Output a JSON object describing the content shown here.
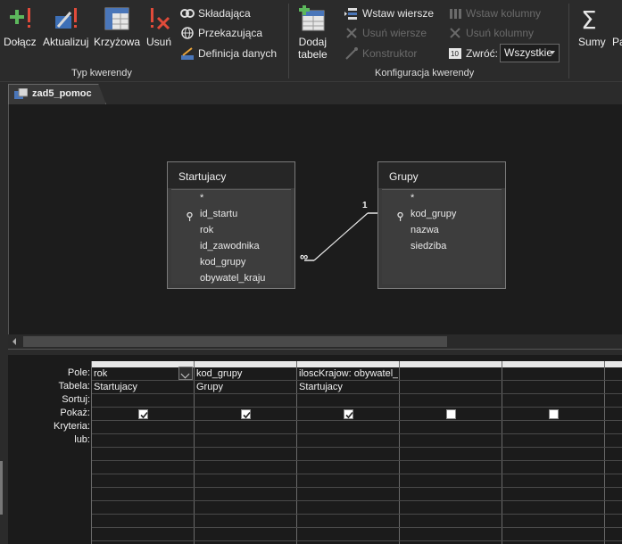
{
  "ribbon": {
    "query_type_group_label": "Typ kwerendy",
    "config_group_label": "Konfiguracja kwerendy",
    "buttons": {
      "append": "Dołącz",
      "update": "Aktualizuj",
      "crosstab": "Krzyżowa",
      "delete": "Usuń",
      "union": "Składająca",
      "passthrough": "Przekazująca",
      "data_definition": "Definicja danych",
      "add_tables_line1": "Dodaj",
      "add_tables_line2": "tabele",
      "insert_rows": "Wstaw wiersze",
      "delete_rows": "Usuń wiersze",
      "builder": "Konstruktor",
      "insert_columns": "Wstaw kolumny",
      "delete_columns": "Usuń kolumny",
      "return_label": "Zwróć:",
      "return_value": "Wszystkie",
      "totals": "Sumy",
      "parameters_partial": "Pa"
    }
  },
  "tab": {
    "label": "zad5_pomoc"
  },
  "tables": [
    {
      "name": "Startujacy",
      "fields": [
        "*",
        "id_startu",
        "rok",
        "id_zawodnika",
        "kod_grupy",
        "obywatel_kraju"
      ]
    },
    {
      "name": "Grupy",
      "fields": [
        "*",
        "kod_grupy",
        "nazwa",
        "siedziba"
      ]
    }
  ],
  "relationship": {
    "one_label": "1",
    "many_label": "∞"
  },
  "grid": {
    "row_labels": [
      "Pole:",
      "Tabela:",
      "Sortuj:",
      "Pokaż:",
      "Kryteria:",
      "lub:"
    ],
    "columns": [
      {
        "field": "rok",
        "table": "Startujacy",
        "show": true
      },
      {
        "field": "kod_grupy",
        "table": "Grupy",
        "show": true
      },
      {
        "field": "iloscKrajow: obywatel_kraju",
        "table": "Startujacy",
        "show": true
      },
      {
        "field": "",
        "table": "",
        "show": false
      },
      {
        "field": "",
        "table": "",
        "show": false
      }
    ]
  }
}
